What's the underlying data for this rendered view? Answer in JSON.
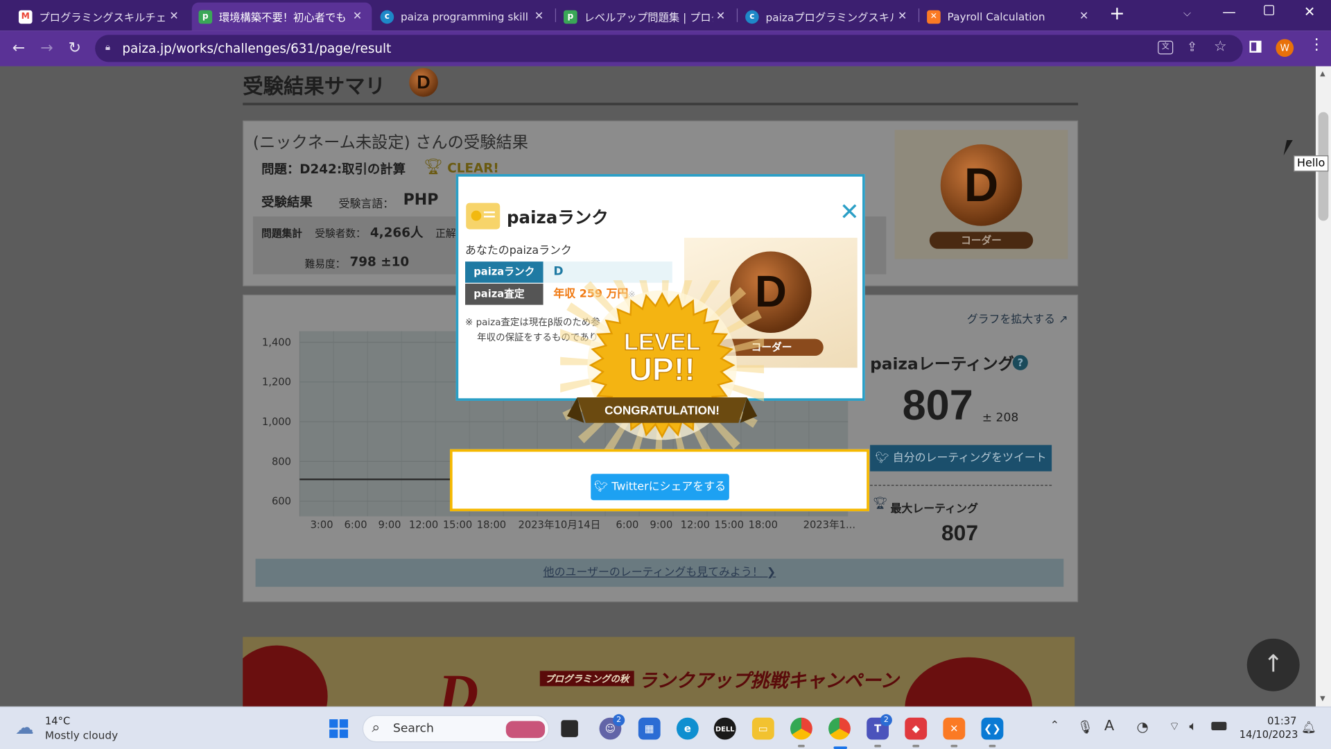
{
  "browser": {
    "tabs": [
      {
        "title": "プログラミングスキルチェックの依",
        "favicon": "gmail-icon",
        "color": "#ea4335"
      },
      {
        "title": "環境構築不要！初心者でも",
        "favicon": "paiza-icon",
        "color": "#3aa757"
      },
      {
        "title": "paiza programming skill ch",
        "favicon": "paiza-c-icon",
        "color": "#1e88c8"
      },
      {
        "title": "レベルアップ問題集 | プログラミ",
        "favicon": "paiza-icon",
        "color": "#3aa757"
      },
      {
        "title": "paizaプログラミングスキルチェッ",
        "favicon": "paiza-c-icon",
        "color": "#1e88c8"
      },
      {
        "title": "Payroll Calculation",
        "favicon": "xampp-icon",
        "color": "#fb7a24"
      }
    ],
    "url": "paiza.jp/works/challenges/631/page/result",
    "profile_initial": "W"
  },
  "page": {
    "summary_title": "受験結果サマリ",
    "rank_letter": "D",
    "user_result": "(ニックネーム未設定) さんの受験結果",
    "problem_label": "問題：D242:取引の計算",
    "clear_text": "CLEAR!",
    "result_label": "受験結果",
    "language_label": "受験言語：",
    "language_value": "PHP",
    "stats_label": "問題集計",
    "examinees_label": "受験者数：",
    "examinees_value": "4,266人",
    "correct_label": "正解",
    "difficulty_label": "難易度：",
    "difficulty_value": "798 ±10",
    "coder_label": "コーダー",
    "expand_graph": "グラフを拡大する",
    "rating_title": "paizaレーティング",
    "rating_value": "807",
    "rating_pm": "± 208",
    "tweet_rating": "自分のレーティングをツイート",
    "max_rating_label": "最大レーティング",
    "max_rating_value": "807",
    "other_users_link": "他のユーザーのレーティングも見てみよう！",
    "banner_small": "プログラミングの秋",
    "banner_main": "ランクアップ挑戦キャンペーン"
  },
  "chart_data": {
    "type": "line",
    "y_ticks": [
      "1,400",
      "1,200",
      "1,000",
      "800",
      "600"
    ],
    "x_ticks": [
      "3:00",
      "6:00",
      "9:00",
      "12:00",
      "15:00",
      "18:00",
      "2023年10月14日",
      "6:00",
      "9:00",
      "12:00",
      "15:00",
      "18:00",
      "2023年1..."
    ],
    "ylim": [
      600,
      1400
    ],
    "series": [
      {
        "values": [
          710,
          710,
          710,
          710
        ]
      }
    ]
  },
  "modal": {
    "title": "paizaランク",
    "subtitle": "あなたのpaizaランク",
    "rank_label": "paizaランク",
    "rank_value": "D",
    "assess_label": "paiza査定",
    "assess_value": "年収 259 万円",
    "assess_mark": "※",
    "note_line1": "※ paiza査定は現在β版のため参",
    "note_line2": "年収の保証をするものであり",
    "coder_label": "コーダー",
    "close_symbol": "✕",
    "level_up_line1": "LEVEL",
    "level_up_line2": "UP!!",
    "congrats": "CONGRATULATION!",
    "twitter_share": "Twitterにシェアをする"
  },
  "overlay": {
    "tooltip": "Hello"
  },
  "taskbar": {
    "weather_temp": "14°C",
    "weather_desc": "Mostly cloudy",
    "search_placeholder": "Search",
    "time": "01:37",
    "date": "14/10/2023",
    "teams_badge": "2",
    "teams2_badge": "2"
  },
  "colors": {
    "tab_bar": "#3c1f70",
    "address_bar": "#5a3296",
    "modal_border": "#2b9fc6",
    "twitter_blue": "#1da1f2",
    "gold": "#f5b800",
    "assess_orange": "#f07a13"
  }
}
